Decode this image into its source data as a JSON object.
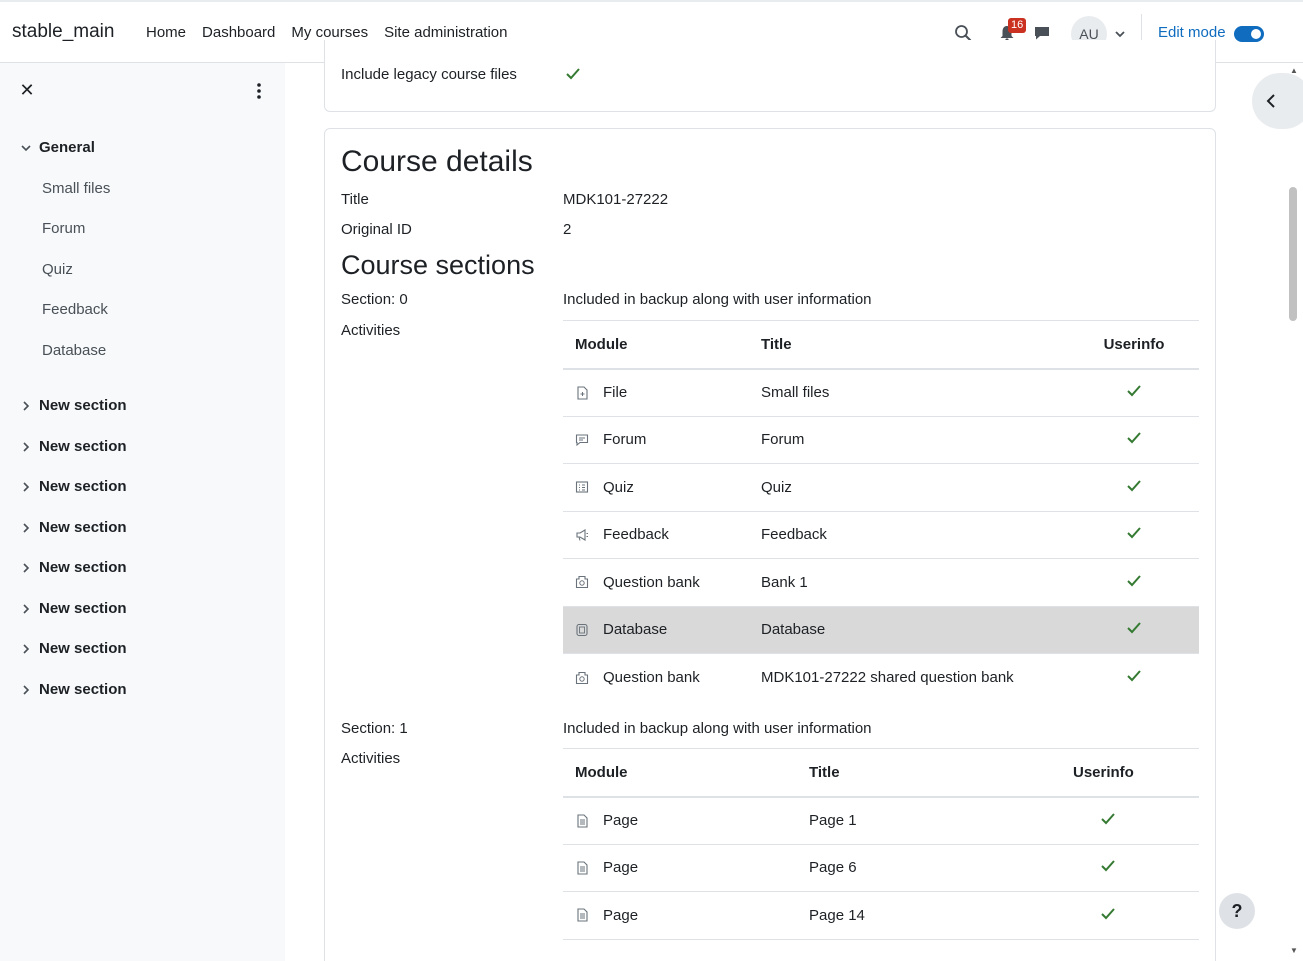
{
  "navbar": {
    "brand": "stable_main",
    "links": [
      "Home",
      "Dashboard",
      "My courses",
      "Site administration"
    ],
    "notification_count": "16",
    "avatar_initials": "AU",
    "edit_mode_label": "Edit mode",
    "edit_mode_on": true
  },
  "drawer": {
    "general_label": "General",
    "general_items": [
      "Small files",
      "Forum",
      "Quiz",
      "Feedback",
      "Database"
    ],
    "sections": [
      "New section",
      "New section",
      "New section",
      "New section",
      "New section",
      "New section",
      "New section",
      "New section"
    ]
  },
  "settings": {
    "legacy_label": "Include legacy course files"
  },
  "course_details": {
    "heading": "Course details",
    "title_label": "Title",
    "title_value": "MDK101-27222",
    "original_id_label": "Original ID",
    "original_id_value": "2",
    "sections_heading": "Course sections",
    "activities_label": "Activities"
  },
  "sections": [
    {
      "label": "Section: 0",
      "status": "Included in backup along with user information",
      "headers": [
        "Module",
        "Title",
        "Userinfo"
      ],
      "rows": [
        {
          "module": "File",
          "icon": "file-icon",
          "title": "Small files"
        },
        {
          "module": "Forum",
          "icon": "forum-icon",
          "title": "Forum"
        },
        {
          "module": "Quiz",
          "icon": "quiz-icon",
          "title": "Quiz"
        },
        {
          "module": "Feedback",
          "icon": "feedback-icon",
          "title": "Feedback"
        },
        {
          "module": "Question bank",
          "icon": "question-bank-icon",
          "title": "Bank 1"
        },
        {
          "module": "Database",
          "icon": "database-icon",
          "title": "Database"
        },
        {
          "module": "Question bank",
          "icon": "question-bank-icon",
          "title": "MDK101-27222 shared question bank"
        }
      ]
    },
    {
      "label": "Section: 1",
      "status": "Included in backup along with user information",
      "headers": [
        "Module",
        "Title",
        "Userinfo"
      ],
      "rows": [
        {
          "module": "Page",
          "icon": "page-icon",
          "title": "Page 1"
        },
        {
          "module": "Page",
          "icon": "page-icon",
          "title": "Page 6"
        },
        {
          "module": "Page",
          "icon": "page-icon",
          "title": "Page 14"
        }
      ]
    }
  ],
  "help_label": "?",
  "colors": {
    "accent": "#0f6cbf",
    "check": "#357a32",
    "badge": "#ca3120",
    "highlight": "#d9d9d9"
  }
}
